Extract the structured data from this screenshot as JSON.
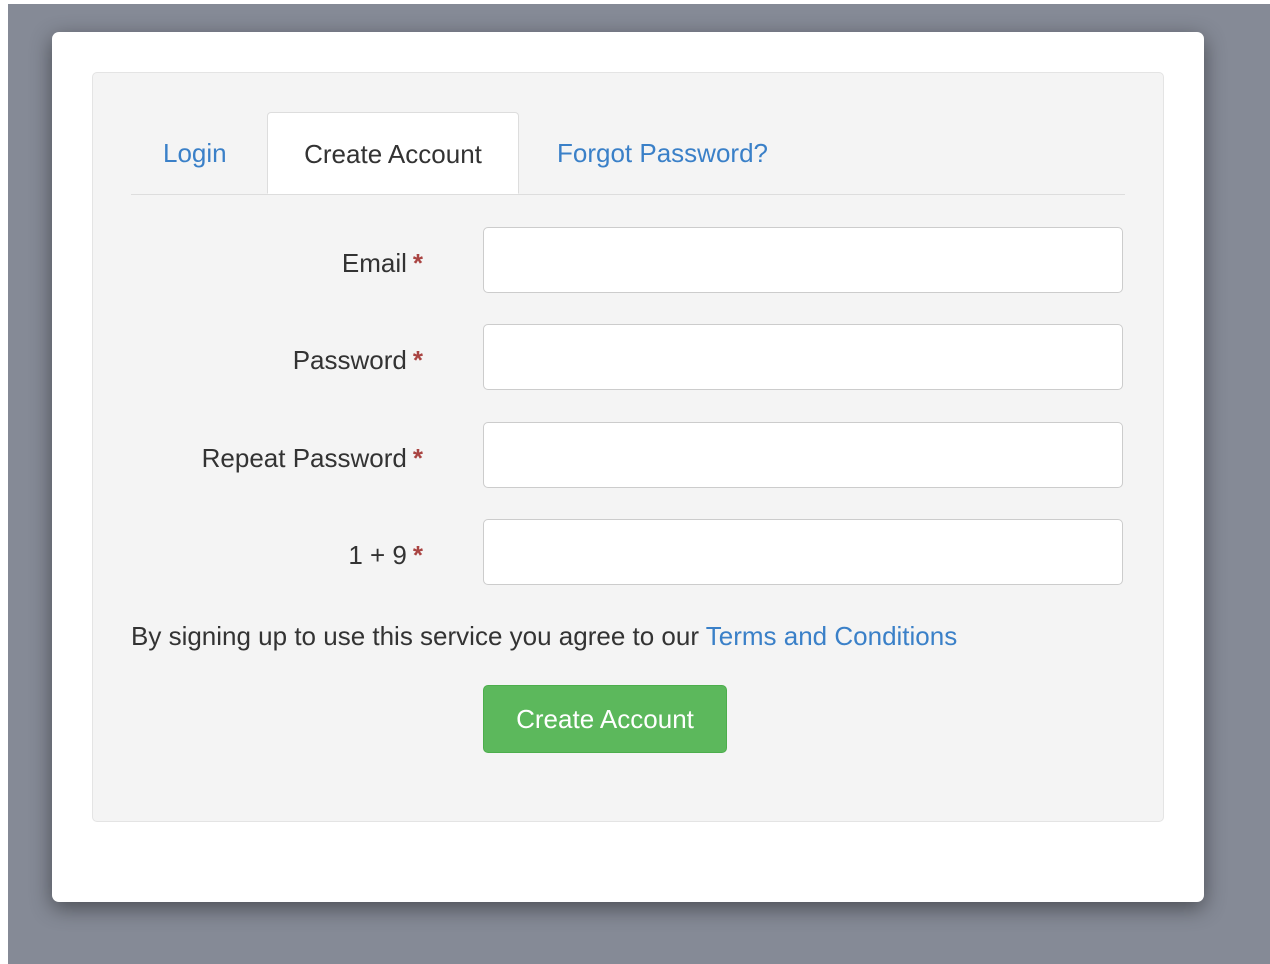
{
  "tabs": {
    "login": "Login",
    "create_account": "Create Account",
    "forgot_password": "Forgot Password?"
  },
  "form": {
    "required_marker": "*",
    "fields": [
      {
        "label": "Email",
        "value": "",
        "placeholder": ""
      },
      {
        "label": "Password",
        "value": "",
        "placeholder": ""
      },
      {
        "label": "Repeat Password",
        "value": "",
        "placeholder": ""
      },
      {
        "label": "1 + 9",
        "value": "",
        "placeholder": ""
      }
    ]
  },
  "terms": {
    "text": "By signing up to use this service you agree to our",
    "link": "Terms and Conditions"
  },
  "submit_label": "Create Account",
  "colors": {
    "backdrop": "#858a96",
    "panel": "#f4f4f4",
    "link": "#3a80c8",
    "button": "#5cb85c",
    "required": "#a94442"
  }
}
